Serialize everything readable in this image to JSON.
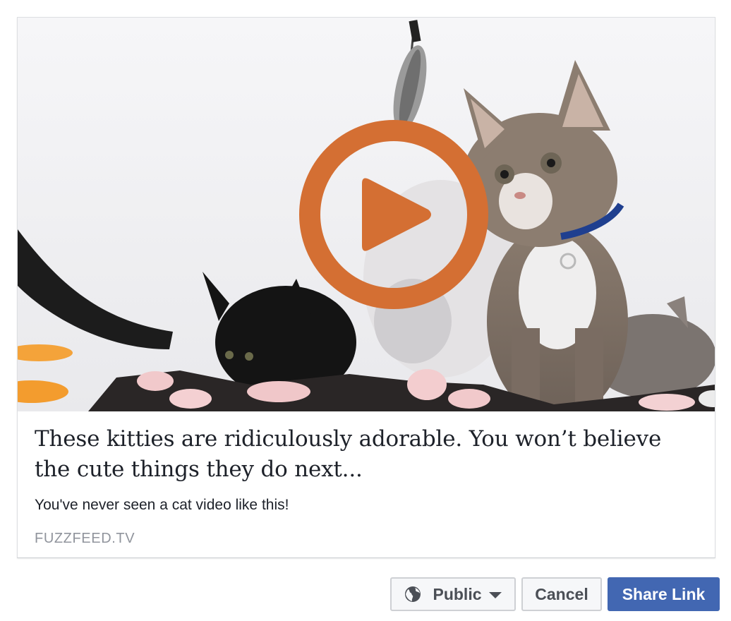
{
  "link_preview": {
    "headline": "These kitties are ridiculously adorable. You won’t believe the cute things they do next...",
    "subtitle": "You've never seen a cat video like this!",
    "domain": "FUZZFEED.TV",
    "media": {
      "type": "video",
      "description_icon": "play-icon",
      "play_color": "#d46f33"
    }
  },
  "actions": {
    "audience_label": "Public",
    "audience_icon": "globe-icon",
    "cancel_label": "Cancel",
    "share_label": "Share Link",
    "share_color": "#4267b2"
  }
}
